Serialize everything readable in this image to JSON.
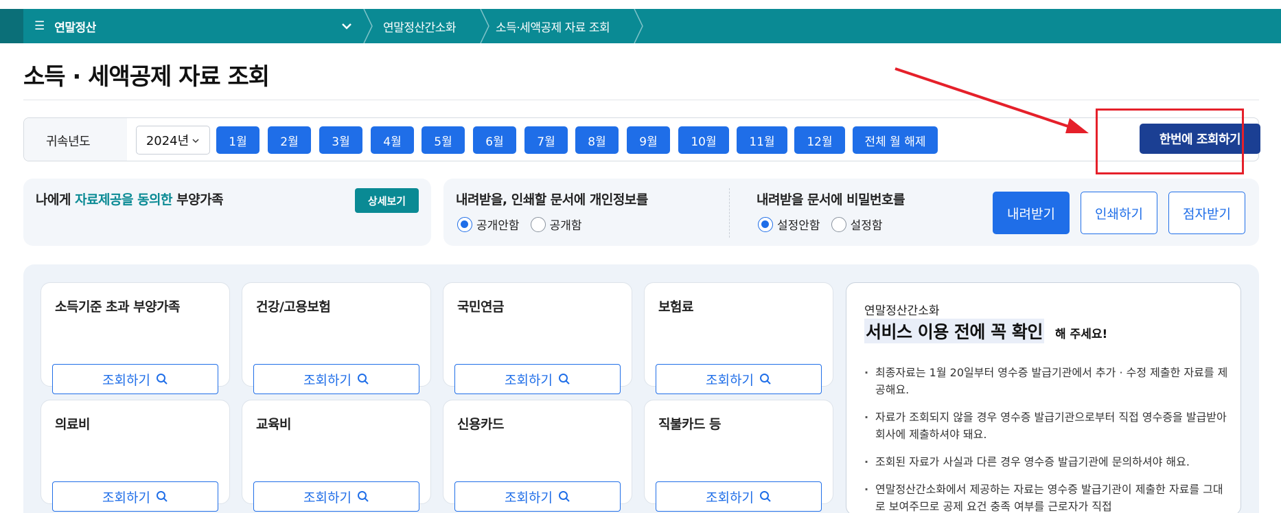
{
  "nav": {
    "menu_title": "연말정산",
    "crumb1": "연말정산간소화",
    "crumb2": "소득·세액공제 자료 조회"
  },
  "page_title": "소득 · 세액공제 자료 조회",
  "yearbar": {
    "label": "귀속년도",
    "year_value": "2024년",
    "months": [
      "1월",
      "2월",
      "3월",
      "4월",
      "5월",
      "6월",
      "7월",
      "8월",
      "9월",
      "10월",
      "11월",
      "12월"
    ],
    "clear_all": "전체 월 해제",
    "query_all": "한번에 조회하기"
  },
  "consent": {
    "pre": "나에게 ",
    "highlight": "자료제공을 동의한",
    "post": " 부양가족",
    "detail_button": "상세보기"
  },
  "privacy": {
    "title": "내려받을, 인쇄할 문서에 개인정보를",
    "opt_hide": "공개안함",
    "opt_show": "공개함",
    "selected": "공개안함"
  },
  "password": {
    "title": "내려받을 문서에 비밀번호를",
    "opt_no": "설정안함",
    "opt_yes": "설정함",
    "selected": "설정안함"
  },
  "actions": {
    "download": "내려받기",
    "print": "인쇄하기",
    "braille": "점자받기"
  },
  "cards": [
    {
      "title": "소득기준 초과 부양가족",
      "button": "조회하기"
    },
    {
      "title": "건강/고용보험",
      "button": "조회하기"
    },
    {
      "title": "국민연금",
      "button": "조회하기"
    },
    {
      "title": "보험료",
      "button": "조회하기"
    },
    {
      "title": "의료비",
      "button": "조회하기"
    },
    {
      "title": "교육비",
      "button": "조회하기"
    },
    {
      "title": "신용카드",
      "button": "조회하기"
    },
    {
      "title": "직불카드 등",
      "button": "조회하기"
    }
  ],
  "info": {
    "subtitle": "연말정산간소화",
    "headline": "서비스 이용 전에 꼭 확인",
    "headline_suffix": "해 주세요!",
    "bullets": [
      "최종자료는 1월 20일부터 영수증 발급기관에서 추가 · 수정 제출한 자료를 제공해요.",
      "자료가 조회되지 않을 경우 영수증 발급기관으로부터 직접 영수증을 발급받아 회사에 제출하셔야 돼요.",
      "조회된 자료가 사실과 다른 경우 영수증 발급기관에 문의하셔야 해요.",
      "연말정산간소화에서 제공하는 자료는 영수증 발급기관이 제출한 자료를 그대로 보여주므로 공제 요건 충족 여부를 근로자가 직접"
    ]
  },
  "colors": {
    "nav_bg": "#0a8a94",
    "primary": "#1f6ee8",
    "query_all_bg": "#1b3f93",
    "annotation_red": "#e5202a"
  }
}
